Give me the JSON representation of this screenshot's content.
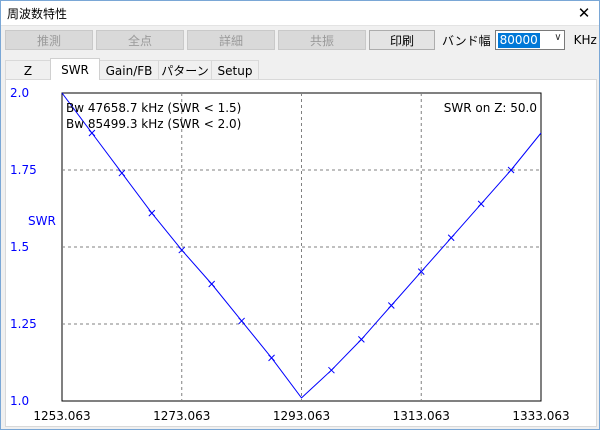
{
  "window": {
    "title": "周波数特性",
    "close_glyph": "✕"
  },
  "toolbar": {
    "buttons": [
      {
        "label": "推測",
        "enabled": false
      },
      {
        "label": "全点",
        "enabled": false
      },
      {
        "label": "詳細",
        "enabled": false
      },
      {
        "label": "共振",
        "enabled": false
      },
      {
        "label": "印刷",
        "enabled": true
      }
    ],
    "band_label": "バンド幅",
    "band_value": "80000",
    "band_unit": "KHz"
  },
  "tabs": [
    {
      "label": "Z",
      "active": false
    },
    {
      "label": "SWR",
      "active": true
    },
    {
      "label": "Gain/FB",
      "active": false
    },
    {
      "label": "パターン",
      "active": false
    },
    {
      "label": "Setup",
      "active": false
    }
  ],
  "chart_data": {
    "type": "line",
    "ylabel": "SWR",
    "ylim": [
      1.0,
      2.0
    ],
    "yticks": [
      "2.0",
      "1.75",
      "1.5",
      "1.25",
      "1.0"
    ],
    "xlim": [
      1253.063,
      1333.063
    ],
    "xticks": [
      "1253.063",
      "1273.063",
      "1293.063",
      "1313.063",
      "1333.063"
    ],
    "grid": true,
    "annotations": {
      "bw15": "Bw 47658.7 kHz (SWR < 1.5)",
      "bw20": "Bw 85499.3 kHz (SWR < 2.0)",
      "z": "SWR on Z: 50.0"
    },
    "series": [
      {
        "color": "#0000ff",
        "x": [
          1253.063,
          1258.063,
          1263.063,
          1268.063,
          1273.063,
          1278.063,
          1283.063,
          1288.063,
          1293.063,
          1298.063,
          1303.063,
          1308.063,
          1313.063,
          1318.063,
          1323.063,
          1328.063,
          1333.063
        ],
        "y": [
          2.0,
          1.87,
          1.74,
          1.61,
          1.49,
          1.38,
          1.26,
          1.14,
          1.01,
          1.1,
          1.2,
          1.31,
          1.42,
          1.53,
          1.64,
          1.75,
          1.87
        ],
        "markers_x": [
          1258.063,
          1263.063,
          1268.063,
          1273.063,
          1278.063,
          1283.063,
          1293.063,
          1298.063,
          1303.063,
          1308.063,
          1313.063,
          1318.063,
          1323.063,
          1328.063
        ],
        "markers_y": [
          1.77,
          1.58,
          1.41,
          1.25,
          1.12,
          1.01,
          1.01,
          1.12,
          1.25,
          1.39,
          1.53,
          1.69,
          1.69,
          1.69
        ]
      }
    ]
  }
}
